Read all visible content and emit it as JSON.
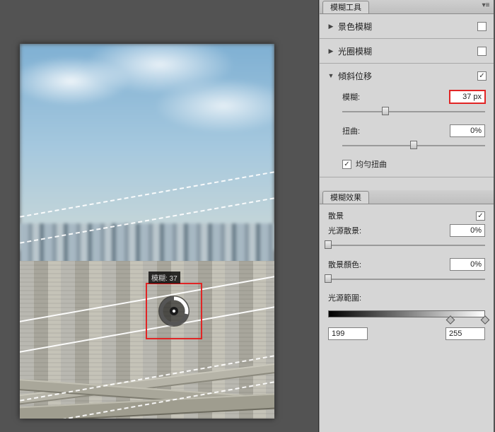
{
  "app": {
    "canvas_blur_label": "模糊: 37"
  },
  "panel_tools": {
    "tab": "模糊工具",
    "rows": [
      {
        "label": "景色模糊",
        "expanded": false,
        "checked": false
      },
      {
        "label": "光圈模糊",
        "expanded": false,
        "checked": false
      },
      {
        "label": "傾斜位移",
        "expanded": true,
        "checked": true
      }
    ],
    "tilt_shift": {
      "blur": {
        "label": "模糊:",
        "value": "37 px",
        "slider_pct": 30
      },
      "distort": {
        "label": "扭曲:",
        "value": "0%",
        "slider_pct": 50
      },
      "uniform_distort": {
        "label": "均勻扭曲",
        "checked": true
      }
    }
  },
  "panel_effects": {
    "tab": "模糊效果",
    "bokeh_row": {
      "label": "散景",
      "checked": true
    },
    "light_bokeh": {
      "label": "光源散景:",
      "value": "0%",
      "slider_pct": 0
    },
    "bokeh_color": {
      "label": "散景顏色:",
      "value": "0%",
      "slider_pct": 0
    },
    "light_range": {
      "label": "光源範圍:",
      "low": "199",
      "high": "255",
      "low_pct": 78,
      "high_pct": 100
    }
  }
}
